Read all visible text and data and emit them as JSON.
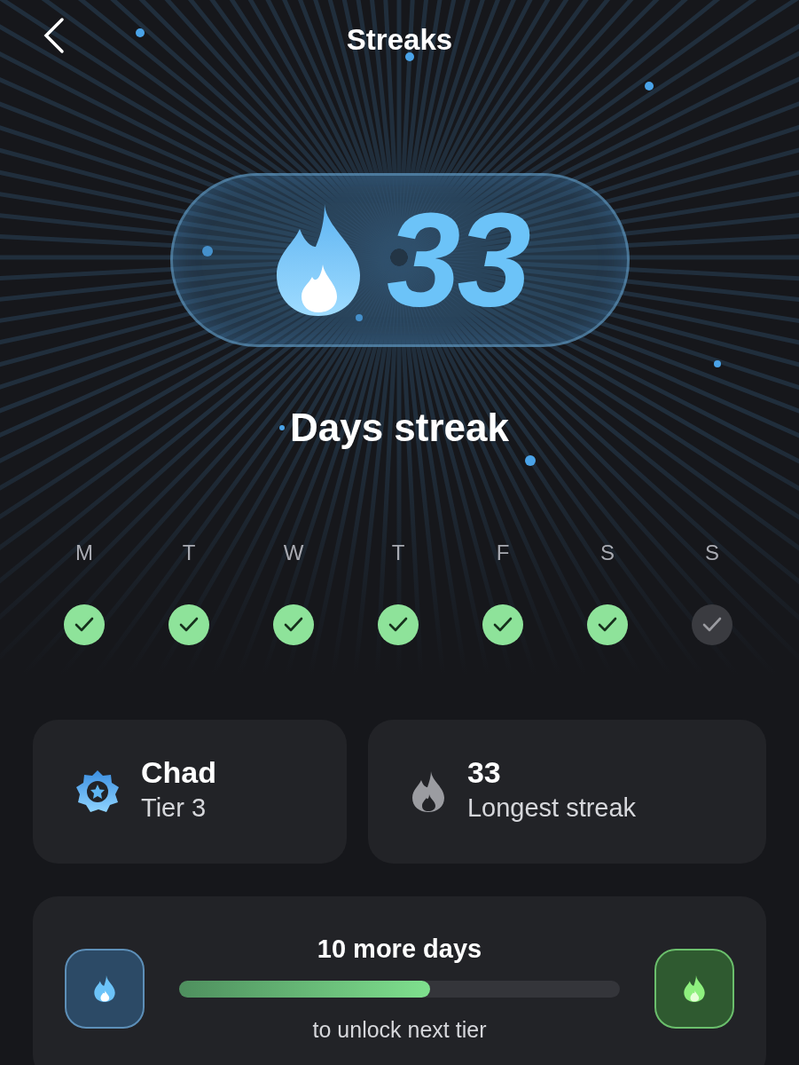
{
  "header": {
    "title": "Streaks"
  },
  "streak": {
    "count": "33",
    "label": "Days streak"
  },
  "week": [
    {
      "day": "M",
      "done": true
    },
    {
      "day": "T",
      "done": true
    },
    {
      "day": "W",
      "done": true
    },
    {
      "day": "T",
      "done": true
    },
    {
      "day": "F",
      "done": true
    },
    {
      "day": "S",
      "done": true
    },
    {
      "day": "S",
      "done": false
    }
  ],
  "stats": [
    {
      "kind": "tier",
      "title": "Chad",
      "subtitle": "Tier 3"
    },
    {
      "kind": "longest",
      "title": "33",
      "subtitle": "Longest streak"
    }
  ],
  "progress": {
    "title": "10 more days",
    "level": 0.57,
    "caption": "to unlock next tier"
  }
}
